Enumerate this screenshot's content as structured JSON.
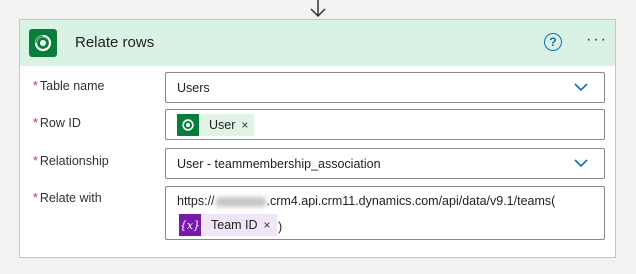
{
  "card": {
    "title": "Relate rows",
    "help_icon": "help-circle-icon",
    "more_icon": "more-horizontal-icon",
    "help_text": "?",
    "more_text": "···"
  },
  "fields": {
    "required_mark": "*",
    "table_name": {
      "label": "Table name",
      "value": "Users"
    },
    "row_id": {
      "label": "Row ID",
      "token": "User",
      "remove": "×"
    },
    "relationship": {
      "label": "Relationship",
      "value": "User - teammembership_association"
    },
    "relate_with": {
      "label": "Relate with",
      "url_prefix": "https://",
      "url_suffix": ".crm4.api.crm11.dynamics.com/api/data/v9.1/teams(",
      "token": "Team ID",
      "token_icon": "{x}",
      "remove": "×",
      "close_paren": ")"
    }
  },
  "colors": {
    "header_bg": "#d9f2e3",
    "brand_green": "#087e3a",
    "expression_purple": "#7719aa",
    "link_blue": "#0f6cbd",
    "required_red": "#d13438"
  }
}
